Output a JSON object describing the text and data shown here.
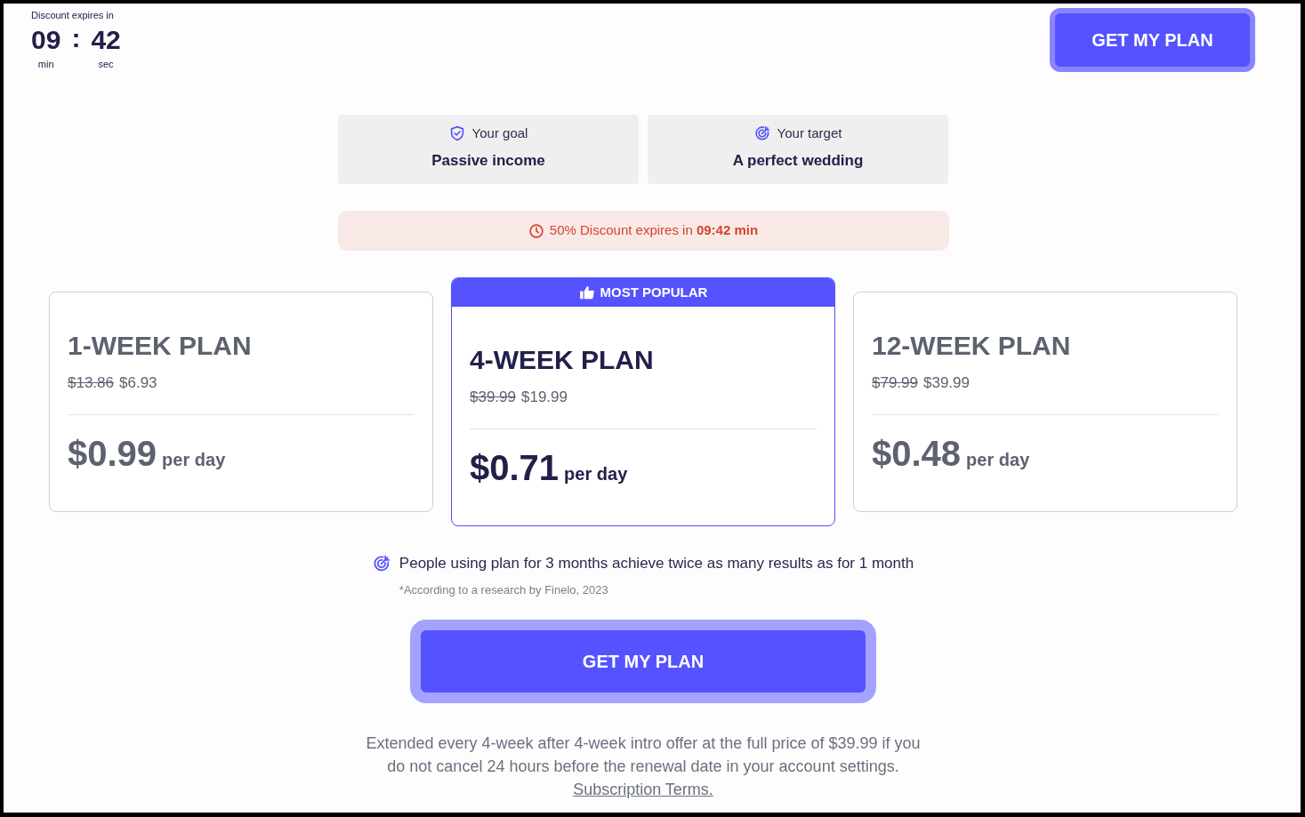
{
  "timer": {
    "label": "Discount expires in",
    "minutes": "09",
    "separator": ":",
    "seconds": "42",
    "minutes_unit": "min",
    "seconds_unit": "sec"
  },
  "header_button": {
    "label": "GET MY PLAN"
  },
  "goal_cards": [
    {
      "kind": "goal",
      "label": "Your goal",
      "value": "Passive income"
    },
    {
      "kind": "target",
      "label": "Your target",
      "value": "A perfect wedding"
    }
  ],
  "discount_banner": {
    "text": "50% Discount expires in **09:42 min**"
  },
  "plans": [
    {
      "name": "1-WEEK PLAN",
      "old_price": "$13.86",
      "price": "$6.93",
      "daily_price": "$0.99",
      "daily_unit": "per day",
      "selected": false
    },
    {
      "badge": "MOST POPULAR",
      "name": "4-WEEK PLAN",
      "old_price": "$39.99",
      "price": "$19.99",
      "daily_price": "$0.71",
      "daily_unit": "per day",
      "selected": true
    },
    {
      "name": "12-WEEK PLAN",
      "old_price": "$79.99",
      "price": "$39.99",
      "daily_price": "$0.48",
      "daily_unit": "per day",
      "selected": false
    }
  ],
  "note": {
    "text": "People using plan for 3 months achieve twice as many results as for 1 month",
    "footnote": "*According to a research by Finelo, 2023"
  },
  "cta_button": {
    "label": "GET MY PLAN"
  },
  "disclaimer": {
    "text": "Extended every 4-week after 4-week intro offer at the full price of $39.99 if you do not cancel 24 hours before the renewal date in your account settings.",
    "link": "Subscription Terms."
  }
}
